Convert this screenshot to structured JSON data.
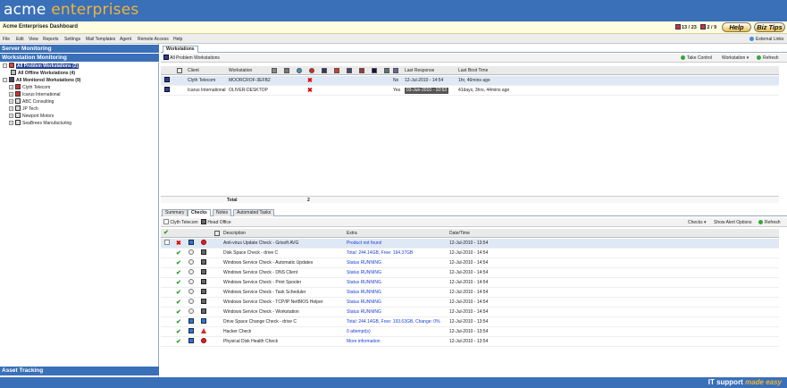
{
  "brand": {
    "part1": "acme",
    "part2": "enterprises"
  },
  "titlebar": {
    "title": "Acme Enterprises Dashboard",
    "count_a": "13 / 23",
    "count_b": "2 / 9",
    "help_label": "Help",
    "biztips_label": "Biz Tips"
  },
  "menu": [
    "File",
    "Edit",
    "View",
    "Reports",
    "Settings",
    "Mail Templates",
    "Agent",
    "Remote Access",
    "Help"
  ],
  "external_links": "External Links",
  "sidebar": {
    "server_monitoring": "Server Monitoring",
    "workstation_monitoring": "Workstation Monitoring",
    "asset_tracking": "Asset Tracking",
    "tree": [
      {
        "label": "All Problem Workstations (2)",
        "bold": true,
        "selected": true
      },
      {
        "label": "All Offline Workstations (4)",
        "bold": true
      },
      {
        "label": "All Monitored Workstations (9)",
        "bold": true
      },
      {
        "label": "Clyth Telecom"
      },
      {
        "label": "Icarus International"
      },
      {
        "label": "ABC Consulting"
      },
      {
        "label": "JP Tech"
      },
      {
        "label": "Newport Motors"
      },
      {
        "label": "SeaBrees Manufacturing"
      }
    ]
  },
  "workstations_tab": "Workstations",
  "ws_toolbar": {
    "path": "All Problem Workstations",
    "take_control": "Take Control",
    "workstation_menu": "Workstation ▾",
    "refresh": "Refresh"
  },
  "ws_columns": {
    "client": "Client",
    "workstation": "Workstation",
    "last_response": "Last Response",
    "last_boot": "Last Boot Time"
  },
  "ws_rows": [
    {
      "client": "Clyth Telecom",
      "workstation": "MOORCROF-3EFB2",
      "flag": "No",
      "last_response": "12-Jul-2010 - 14:54",
      "last_boot": "1hr, 46mins ago"
    },
    {
      "client": "Icarus International",
      "workstation": "OLIVER-DESKTOP",
      "flag": "Yes",
      "last_response": "03-Jun-2010 - 10:53",
      "last_boot": "41days, 3hrs, 44mins ago"
    }
  ],
  "total": {
    "label": "Total",
    "value": "2"
  },
  "bottom_tabs": [
    "Summary",
    "Checks",
    "Notes",
    "Automated Tasks"
  ],
  "checks_toolbar": {
    "client": "Clyth Telecom",
    "office": "Head Office",
    "checks_menu": "Checks ▾",
    "show_alert": "Show Alert Options",
    "refresh": "Refresh"
  },
  "check_columns": {
    "description": "Description",
    "extra": "Extra",
    "datetime": "Date/Time"
  },
  "checks": [
    {
      "status": "fail",
      "description": "Anti-virus Update Check - Grisoft AVG",
      "extra": "Product not found",
      "datetime": "12-Jul-2010 - 13:54"
    },
    {
      "status": "ok",
      "description": "Disk Space Check - drive C",
      "extra": "Total: 244.14GB, Free: 194.37GB",
      "datetime": "12-Jul-2010 - 14:54"
    },
    {
      "status": "ok",
      "description": "Windows Service Check - Automatic Updates",
      "extra": "Status RUNNING",
      "datetime": "12-Jul-2010 - 14:54"
    },
    {
      "status": "ok",
      "description": "Windows Service Check - DNS Client",
      "extra": "Status RUNNING",
      "datetime": "12-Jul-2010 - 14:54"
    },
    {
      "status": "ok",
      "description": "Windows Service Check - Print Spooler",
      "extra": "Status RUNNING",
      "datetime": "12-Jul-2010 - 14:54"
    },
    {
      "status": "ok",
      "description": "Windows Service Check - Task Scheduler",
      "extra": "Status RUNNING",
      "datetime": "12-Jul-2010 - 14:54"
    },
    {
      "status": "ok",
      "description": "Windows Service Check - TCP/IP NetBIOS Helper",
      "extra": "Status RUNNING",
      "datetime": "12-Jul-2010 - 14:54"
    },
    {
      "status": "ok",
      "description": "Windows Service Check - Workstation",
      "extra": "Status RUNNING",
      "datetime": "12-Jul-2010 - 14:54"
    },
    {
      "status": "ok",
      "description": "Drive Space Change Check - drive C",
      "extra": "Total: 244.14GB, Free: 193.63GB, Change: 0%",
      "datetime": "12-Jul-2010 - 13:54"
    },
    {
      "status": "ok",
      "description": "Hacker Check",
      "extra": "0 attempt(s)",
      "datetime": "12-Jul-2010 - 13:54"
    },
    {
      "status": "ok",
      "description": "Physical Disk Health Check",
      "extra": "More information",
      "datetime": "12-Jul-2010 - 13:54"
    }
  ],
  "footer": {
    "slogan_a": "IT support",
    "slogan_b": "made easy"
  }
}
